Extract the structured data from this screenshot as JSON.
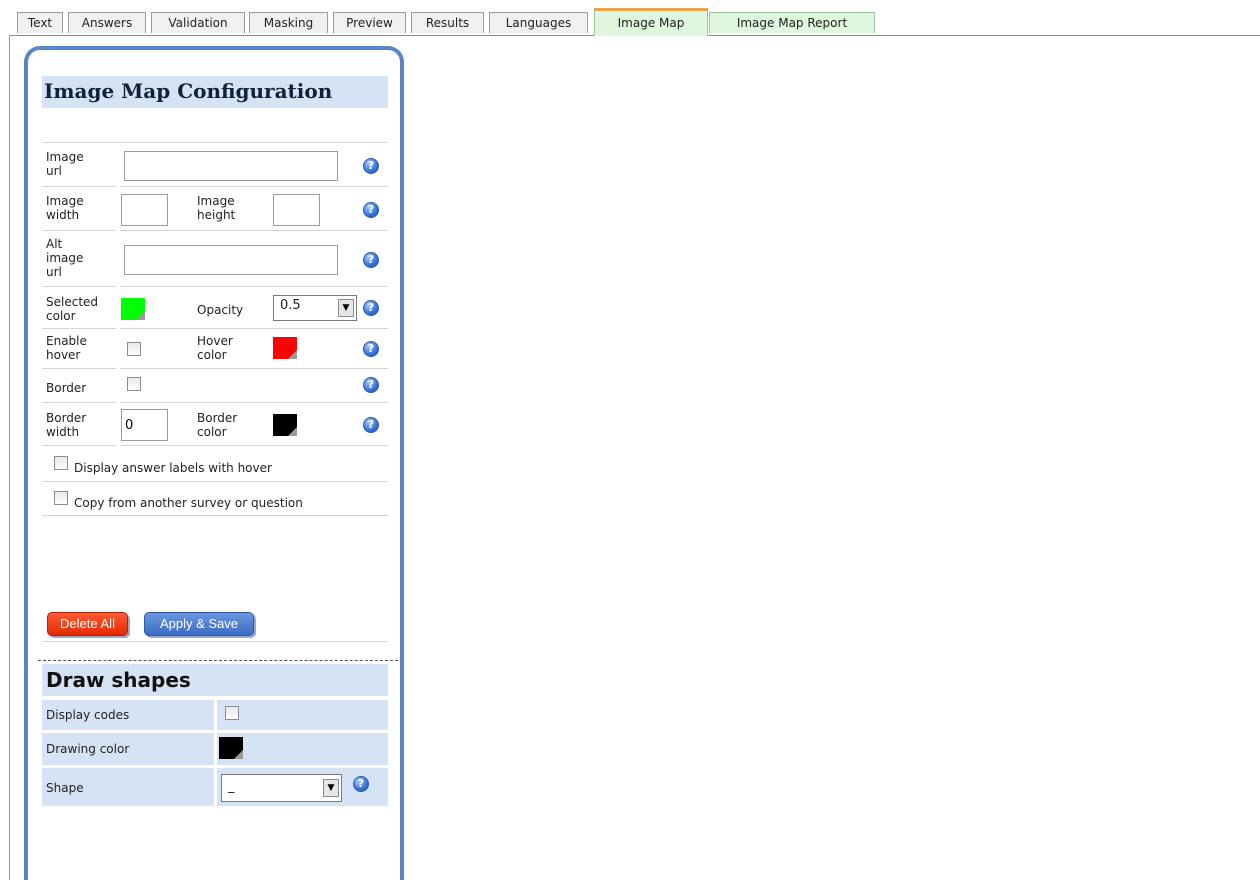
{
  "tabs": [
    {
      "label": "Text"
    },
    {
      "label": "Answers"
    },
    {
      "label": "Validation"
    },
    {
      "label": "Masking"
    },
    {
      "label": "Preview"
    },
    {
      "label": "Results"
    },
    {
      "label": "Languages"
    },
    {
      "label": "Image Map"
    },
    {
      "label": "Image Map Report"
    }
  ],
  "active_tab": "Image Map",
  "config": {
    "title": "Image Map Configuration",
    "image_url_label": "Image\nurl",
    "image_url_value": "",
    "image_width_label": "Image\nwidth",
    "image_width_value": "",
    "image_height_label": "Image\nheight",
    "image_height_value": "",
    "alt_image_url_label": "Alt\nimage\nurl",
    "alt_image_url_value": "",
    "selected_color_label": "Selected\ncolor",
    "selected_color": "#00ff00",
    "opacity_label": "Opacity",
    "opacity_value": "0.5",
    "enable_hover_label": "Enable\nhover",
    "enable_hover_checked": false,
    "hover_color_label": "Hover\ncolor",
    "hover_color": "#ff0000",
    "border_label": "Border",
    "border_checked": false,
    "border_width_label": "Border\nwidth",
    "border_width_value": "0",
    "border_color_label": "Border\ncolor",
    "border_color": "#000000",
    "display_labels_text": "Display answer labels with hover",
    "copy_text": "Copy from another survey or question",
    "help_glyph": "?"
  },
  "buttons": {
    "delete_all": "Delete All",
    "apply_save": "Apply & Save"
  },
  "draw": {
    "title": "Draw shapes",
    "display_codes_label": "Display codes",
    "display_codes_checked": false,
    "drawing_color_label": "Drawing color",
    "drawing_color": "#000000",
    "shape_label": "Shape",
    "shape_value": "_"
  }
}
